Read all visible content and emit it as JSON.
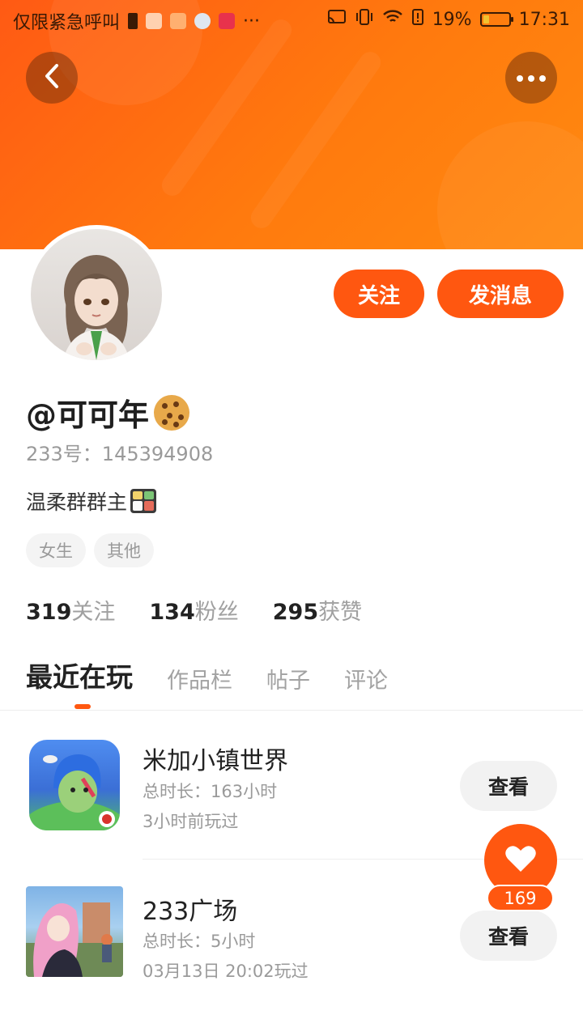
{
  "status_bar": {
    "carrier_text": "仅限紧急呼叫",
    "more_indicator": "···",
    "battery": "19%",
    "time": "17:31"
  },
  "header": {
    "back_icon": "chevron-left-icon",
    "more_icon": "more-horizontal-icon"
  },
  "profile": {
    "username": "@可可年",
    "username_emoji_icon": "cookie-icon",
    "id_text": "233号：145394908",
    "bio": "温柔群群主",
    "bio_emoji_icon": "bento-box-icon",
    "tags": [
      "女生",
      "其他"
    ],
    "buttons": {
      "follow": "关注",
      "message": "发消息"
    }
  },
  "stats": [
    {
      "num": "319",
      "label": "关注"
    },
    {
      "num": "134",
      "label": "粉丝"
    },
    {
      "num": "295",
      "label": "获赞"
    }
  ],
  "tabs": [
    "最近在玩",
    "作品栏",
    "帖子",
    "评论"
  ],
  "games": [
    {
      "name": "米加小镇世界",
      "duration": "总时长：163小时",
      "last_played": "3小时前玩过",
      "button": "查看"
    },
    {
      "name": "233广场",
      "duration": "总时长：5小时",
      "last_played": "03月13日 20:02玩过",
      "button": "查看"
    }
  ],
  "like": {
    "icon": "heart-icon",
    "count": "169"
  },
  "colors": {
    "accent": "#ff5710",
    "banner": "#ff7a0e"
  }
}
